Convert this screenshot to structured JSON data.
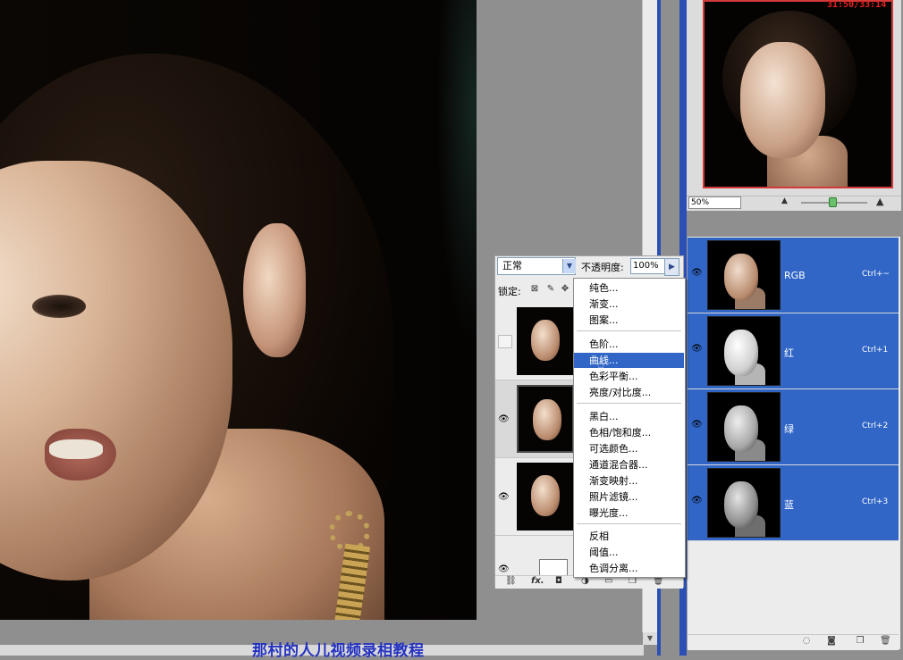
{
  "timer": "31:50/33:14",
  "caption": "那村的人儿视频录相教程",
  "navigator": {
    "zoom": "50%",
    "zoom_out_icon": "small-mountain-icon",
    "zoom_in_icon": "large-mountain-icon"
  },
  "layers": {
    "blend_mode": "正常",
    "opacity_label": "不透明度:",
    "opacity_value": "100%",
    "lock_label": "锁定:",
    "footer_icons": [
      "link-icon",
      "fx-icon",
      "mask-icon",
      "adjustment-icon",
      "folder-icon",
      "new-layer-icon",
      "trash-icon"
    ],
    "footer_fx": "fx."
  },
  "menu": {
    "groups": [
      [
        "纯色...",
        "渐变...",
        "图案..."
      ],
      [
        "色阶...",
        "曲线...",
        "色彩平衡...",
        "亮度/对比度..."
      ],
      [
        "黑白...",
        "色相/饱和度...",
        "可选颜色...",
        "通道混合器...",
        "渐变映射...",
        "照片滤镜...",
        "曝光度..."
      ],
      [
        "反相",
        "阈值...",
        "色调分离..."
      ]
    ],
    "highlighted": "曲线..."
  },
  "channels": {
    "rows": [
      {
        "name": "RGB",
        "shortcut": "Ctrl+~"
      },
      {
        "name": "红",
        "shortcut": "Ctrl+1"
      },
      {
        "name": "绿",
        "shortcut": "Ctrl+2"
      },
      {
        "name": "蓝",
        "shortcut": "Ctrl+3"
      }
    ],
    "footer_icons": [
      "load-selection-icon",
      "save-selection-icon",
      "new-channel-icon",
      "trash-icon"
    ]
  },
  "colors": {
    "selection_blue": "#3166c6",
    "caption_blue": "#2432c0",
    "timer_red": "#e52020",
    "nav_frame_red": "#d23a3a"
  }
}
